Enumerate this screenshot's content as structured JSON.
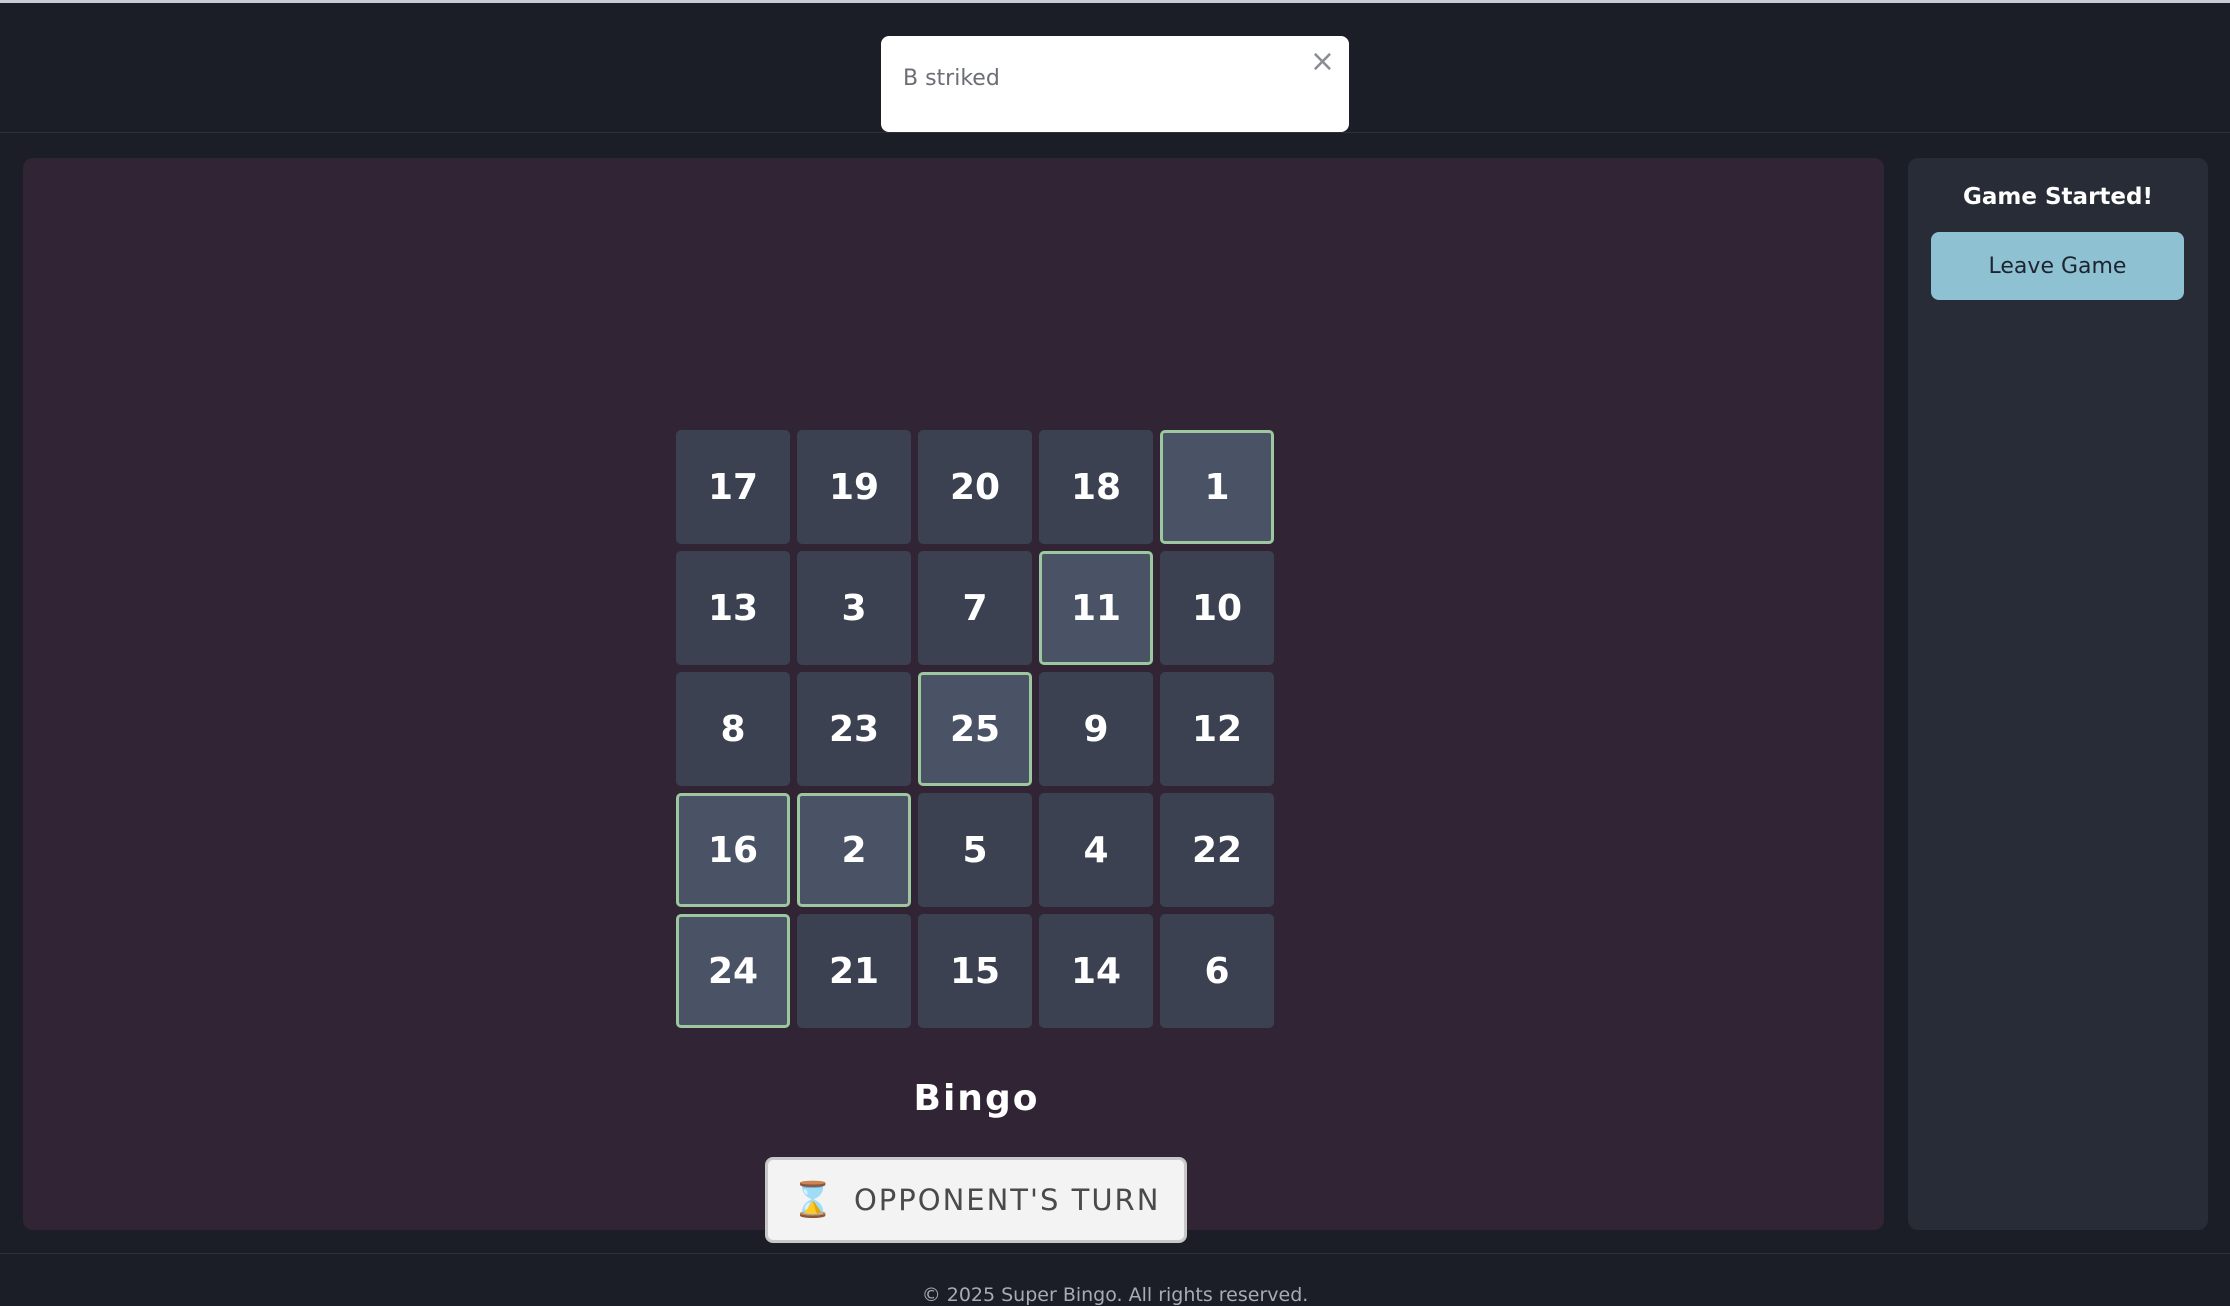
{
  "toast": {
    "message": "B striked",
    "close_glyph": "×"
  },
  "board": {
    "cells": [
      {
        "value": "17",
        "striked": false
      },
      {
        "value": "19",
        "striked": false
      },
      {
        "value": "20",
        "striked": false
      },
      {
        "value": "18",
        "striked": false
      },
      {
        "value": "1",
        "striked": true
      },
      {
        "value": "13",
        "striked": false
      },
      {
        "value": "3",
        "striked": false
      },
      {
        "value": "7",
        "striked": false
      },
      {
        "value": "11",
        "striked": true
      },
      {
        "value": "10",
        "striked": false
      },
      {
        "value": "8",
        "striked": false
      },
      {
        "value": "23",
        "striked": false
      },
      {
        "value": "25",
        "striked": true
      },
      {
        "value": "9",
        "striked": false
      },
      {
        "value": "12",
        "striked": false
      },
      {
        "value": "16",
        "striked": true
      },
      {
        "value": "2",
        "striked": true
      },
      {
        "value": "5",
        "striked": false
      },
      {
        "value": "4",
        "striked": false
      },
      {
        "value": "22",
        "striked": false
      },
      {
        "value": "24",
        "striked": true
      },
      {
        "value": "21",
        "striked": false
      },
      {
        "value": "15",
        "striked": false
      },
      {
        "value": "14",
        "striked": false
      },
      {
        "value": "6",
        "striked": false
      }
    ],
    "title": "Bingo",
    "turn_label": "OPPONENT'S TURN",
    "turn_icon": "hourglass-icon"
  },
  "sidebar": {
    "status": "Game Started!",
    "leave_label": "Leave Game"
  },
  "footer": {
    "copyright": "© 2025 Super Bingo. All rights reserved."
  },
  "colors": {
    "page_bg": "#1b1e27",
    "board_panel_bg": "#312435",
    "cell_bg": "#3b4150",
    "striked_border": "#9cc79f",
    "leave_button": "#8ec2d2"
  }
}
